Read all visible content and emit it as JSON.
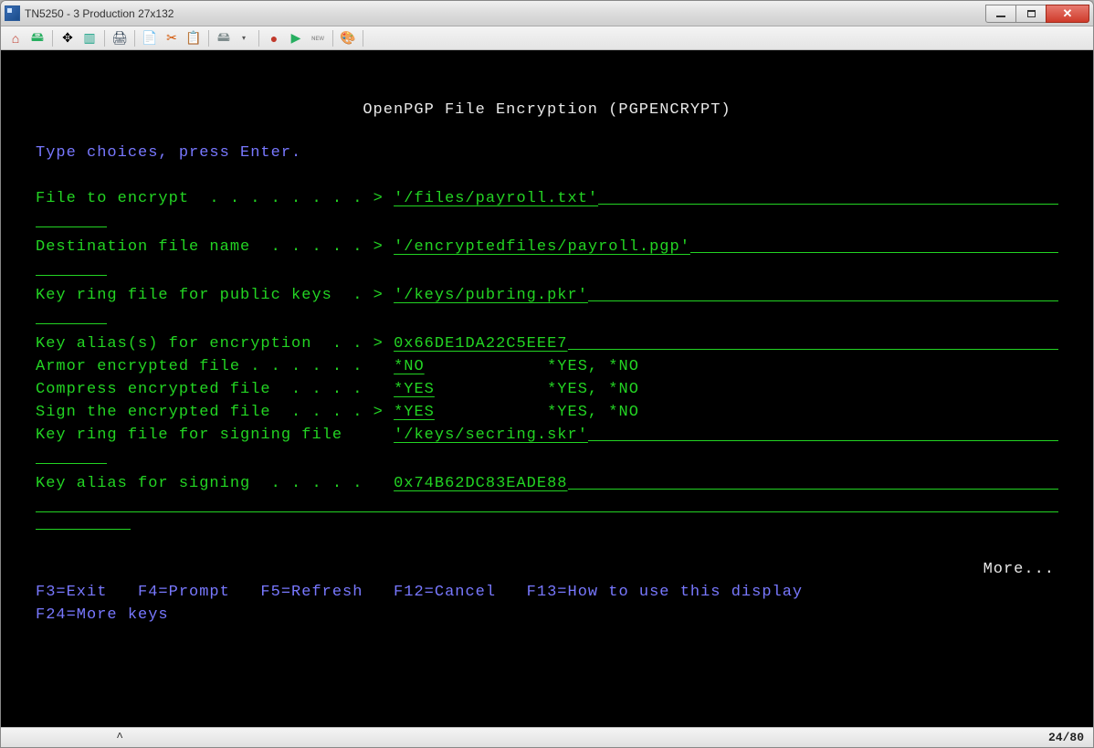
{
  "window": {
    "title": "TN5250 - 3 Production 27x132"
  },
  "toolbar_icons": {
    "i1": "⌂",
    "i2": "🖴",
    "i3": "✥",
    "i4": "▥",
    "i5": "🖨",
    "i6": "📄",
    "i7": "✂",
    "i8": "📋",
    "i9": "🖴",
    "i10": "▾",
    "i11": "●",
    "i12": "▶",
    "i13": "ɴᴇᴡ",
    "i14": "🎨"
  },
  "screen": {
    "title": "OpenPGP File Encryption (PGPENCRYPT)",
    "instruction": "Type choices, press Enter.",
    "fields": {
      "file_to_encrypt": {
        "label": "File to encrypt  . . . . . . . . > ",
        "value": "'/files/payroll.txt'"
      },
      "dest_file": {
        "label": "Destination file name  . . . . . > ",
        "value": "'/encryptedfiles/payroll.pgp'"
      },
      "pub_keyring": {
        "label": "Key ring file for public keys  . > ",
        "value": "'/keys/pubring.pkr'"
      },
      "key_alias_enc": {
        "label": "Key alias(s) for encryption  . . > ",
        "value": "0x66DE1DA22C5EEE7"
      },
      "armor": {
        "label": "Armor encrypted file . . . . . .   ",
        "value": "*NO ",
        "options": "*YES, *NO"
      },
      "compress": {
        "label": "Compress encrypted file  . . . .   ",
        "value": "*YES",
        "options": "*YES, *NO"
      },
      "sign": {
        "label": "Sign the encrypted file  . . . . > ",
        "value": "*YES",
        "options": "*YES, *NO"
      },
      "sign_keyring": {
        "label": "Key ring file for signing file     ",
        "value": "'/keys/secring.skr'"
      },
      "key_alias_sign": {
        "label": "Key alias for signing  . . . . .   ",
        "value": "0x74B62DC83EADE88"
      }
    },
    "more": "More...",
    "fkeys_line1": "F3=Exit   F4=Prompt   F5=Refresh   F12=Cancel   F13=How to use this display",
    "fkeys_line2": "F24=More keys"
  },
  "status": {
    "caret": "^",
    "position": "24/80"
  }
}
